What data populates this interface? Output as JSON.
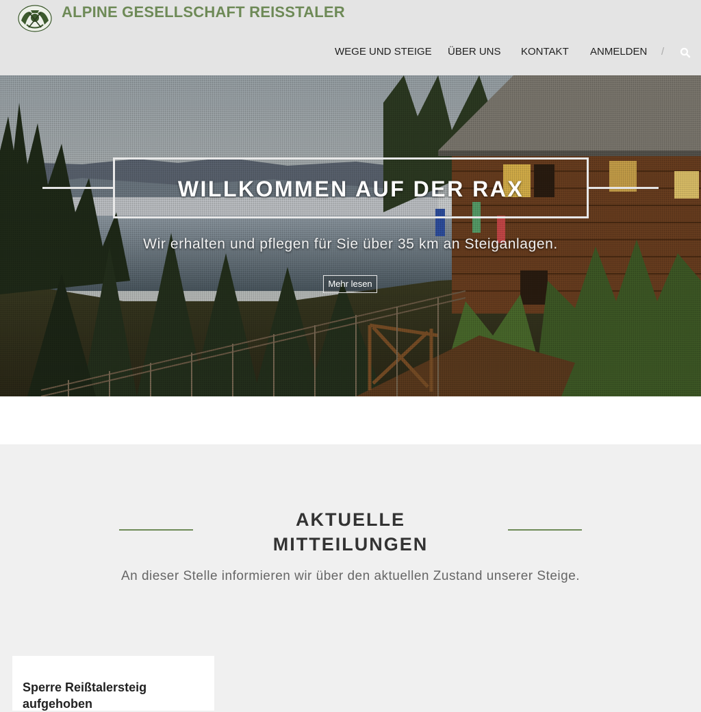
{
  "site": {
    "title": "ALPINE GESELLSCHAFT REISSTALER",
    "brand_color": "#6e8a57"
  },
  "nav": {
    "items": [
      {
        "label": "WEGE UND STEIGE"
      },
      {
        "label": "ÜBER UNS"
      },
      {
        "label": "KONTAKT"
      },
      {
        "label": "ANMELDEN"
      }
    ],
    "separator": "/",
    "search_icon": "search-icon"
  },
  "hero": {
    "title": "WILLKOMMEN AUF DER RAX",
    "subtitle": "Wir erhalten und pflegen für Sie über 35 km an Steiganlagen.",
    "button_label": "Mehr lesen"
  },
  "news": {
    "title": "AKTUELLE MITTEILUNGEN",
    "subtitle": "An dieser Stelle informieren wir über den aktuellen Zustand unserer Steige.",
    "cards": [
      {
        "title": "Sperre Reißtalersteig aufgehoben"
      }
    ]
  }
}
